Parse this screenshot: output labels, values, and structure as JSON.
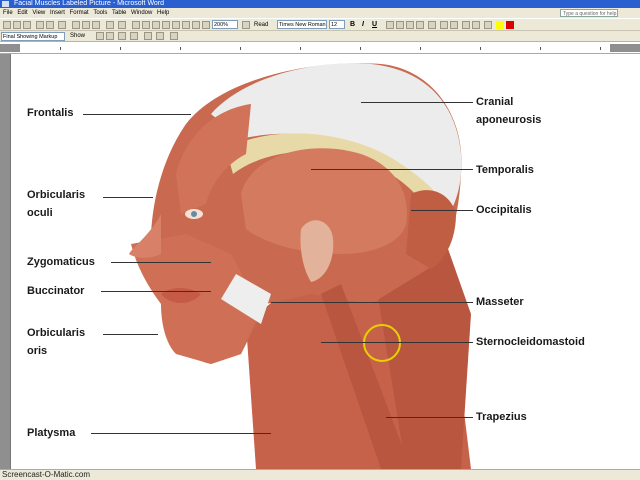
{
  "window": {
    "title": "Facial Muscles Labeled Picture - Microsoft Word"
  },
  "menu": {
    "items": [
      "File",
      "Edit",
      "View",
      "Insert",
      "Format",
      "Tools",
      "Table",
      "Window",
      "Help"
    ],
    "help_placeholder": "Type a question for help"
  },
  "toolbar": {
    "zoom": "200%",
    "read": "Read",
    "font": "Times New Roman",
    "size": "12"
  },
  "toolbar2": {
    "markup_view": "Final Showing Markup",
    "show": "Show"
  },
  "diagram": {
    "labels": {
      "frontalis": "Frontalis",
      "cranial_aponeurosis_1": "Cranial",
      "cranial_aponeurosis_2": "aponeurosis",
      "temporalis": "Temporalis",
      "orbicularis_oculi_1": "Orbicularis",
      "orbicularis_oculi_2": "oculi",
      "occipitalis": "Occipitalis",
      "zygomaticus": "Zygomaticus",
      "buccinator": "Buccinator",
      "masseter": "Masseter",
      "orbicularis_oris_1": "Orbicularis",
      "orbicularis_oris_2": "oris",
      "sternocleidomastoid": "Sternocleidomastoid",
      "trapezius": "Trapezius",
      "platysma": "Platysma"
    }
  },
  "status": {
    "watermark": "Screencast-O-Matic.com"
  },
  "colors": {
    "titlebar": "#2a5fd0",
    "muscle": "#c96a50",
    "highlight_circle": "#e8d000"
  }
}
